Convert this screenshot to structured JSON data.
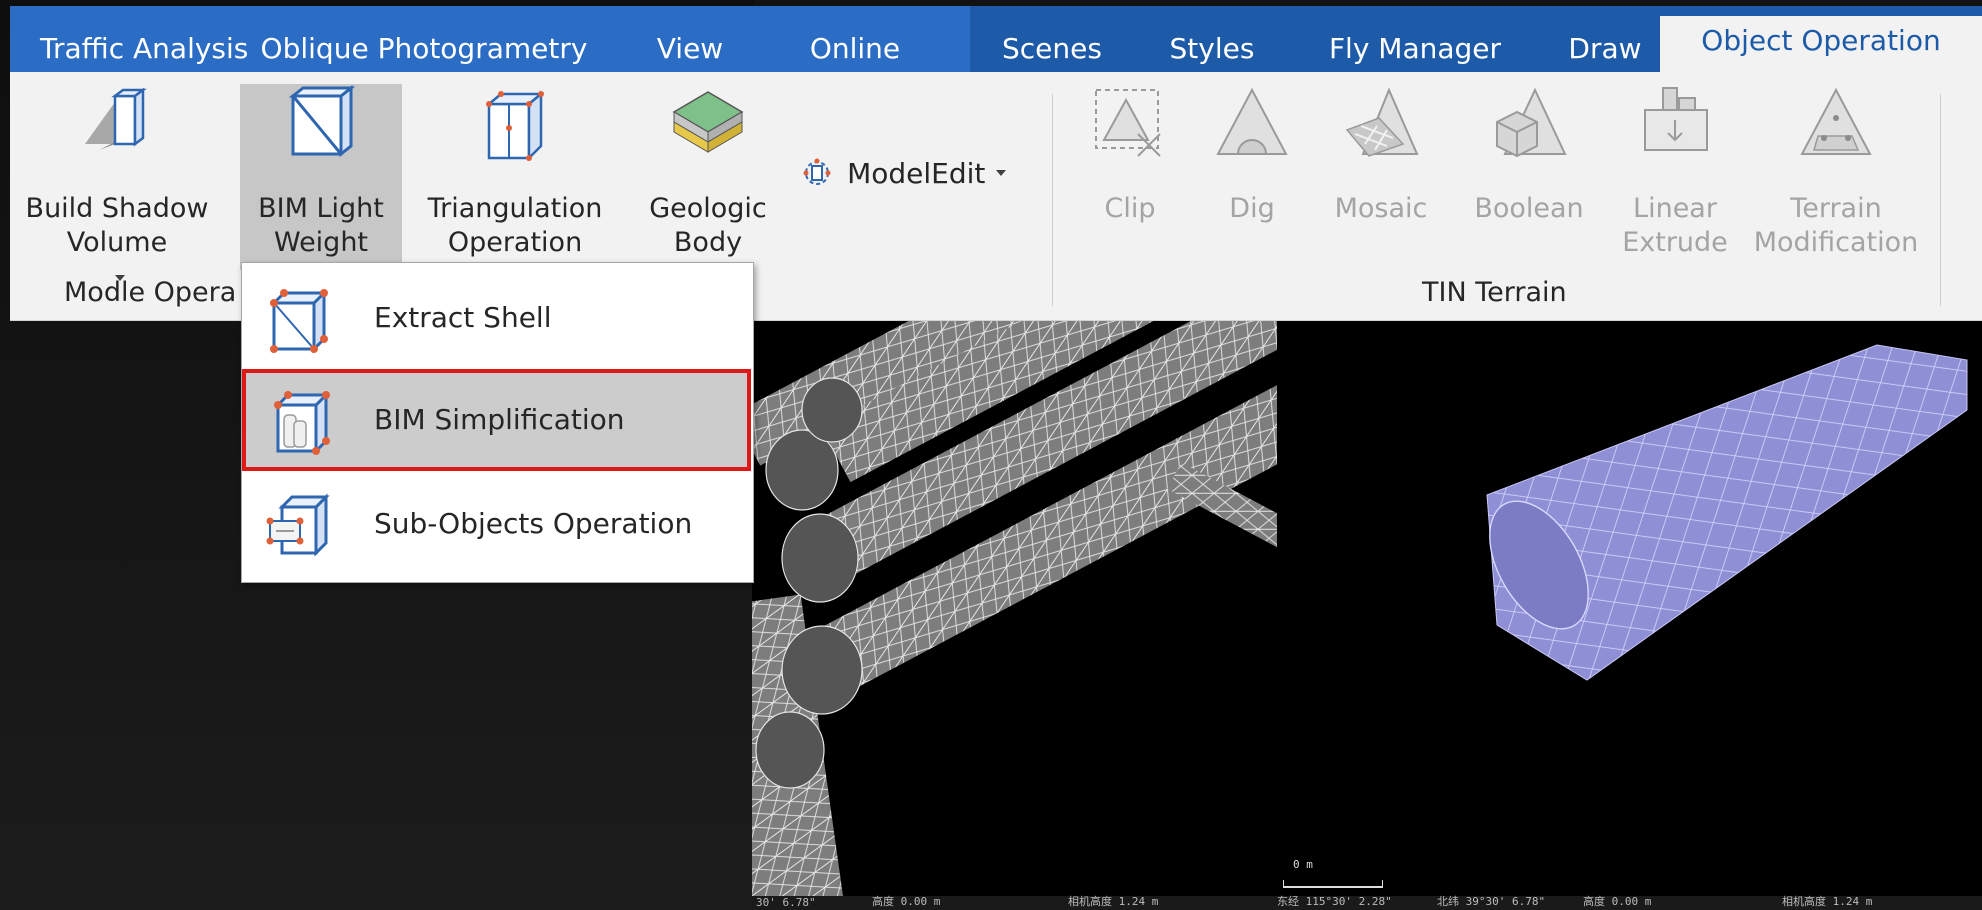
{
  "tabs": [
    {
      "label": "Traffic Analysis"
    },
    {
      "label": "Oblique Photogrametry"
    },
    {
      "label": "View"
    },
    {
      "label": "Online"
    },
    {
      "label": "Scenes"
    },
    {
      "label": "Styles"
    },
    {
      "label": "Fly Manager"
    },
    {
      "label": "Draw"
    },
    {
      "label": "Object Operation",
      "active": true
    }
  ],
  "model_group": {
    "label": "Modle Opera",
    "buttons": [
      {
        "line1": "Build Shadow",
        "line2": "Volume",
        "icon": "shadow-volume-icon"
      },
      {
        "line1": "BIM Light",
        "line2": "Weight",
        "icon": "bim-lightweight-icon",
        "pressed": true
      },
      {
        "line1": "Triangulation",
        "line2": "Operation",
        "icon": "triangulation-icon"
      },
      {
        "line1": "Geologic",
        "line2": "Body",
        "icon": "geologic-body-icon"
      }
    ],
    "model_edit": {
      "label": "ModelEdit",
      "icon": "model-edit-icon"
    }
  },
  "tin_group": {
    "label": "TIN Terrain",
    "buttons": [
      {
        "line1": "Clip",
        "line2": "",
        "icon": "clip-icon"
      },
      {
        "line1": "Dig",
        "line2": "",
        "icon": "dig-icon"
      },
      {
        "line1": "Mosaic",
        "line2": "",
        "icon": "mosaic-icon"
      },
      {
        "line1": "Boolean",
        "line2": "",
        "icon": "boolean-icon"
      },
      {
        "line1": "Linear",
        "line2": "Extrude",
        "icon": "linear-extrude-icon"
      },
      {
        "line1": "Terrain",
        "line2": "Modification",
        "icon": "terrain-modification-icon"
      }
    ]
  },
  "dropdown": {
    "items": [
      {
        "label": "Extract Shell",
        "icon": "extract-shell-icon"
      },
      {
        "label": "BIM Simplification",
        "icon": "bim-simplification-icon",
        "selected": true
      },
      {
        "label": "Sub-Objects Operation",
        "icon": "sub-objects-icon"
      }
    ]
  },
  "status_bar_left": {
    "lon": "30' 6.78\"",
    "height": "高度 0.00 m",
    "camera": "相机高度 1.24 m"
  },
  "status_bar_right": {
    "lon": "东经 115°30' 2.28\"",
    "lat": "北纬 39°30' 6.78\"",
    "height": "高度 0.00 m",
    "camera": "相机高度 1.24 m"
  },
  "scale_bar": {
    "label": "0 m"
  },
  "colors": {
    "tab_bar": "#2b6cc4",
    "tab_group": "#1d5aa8",
    "ribbon": "#f2f2f2",
    "highlight": "#e01818",
    "pipe_selected": "#8f8fd6"
  }
}
